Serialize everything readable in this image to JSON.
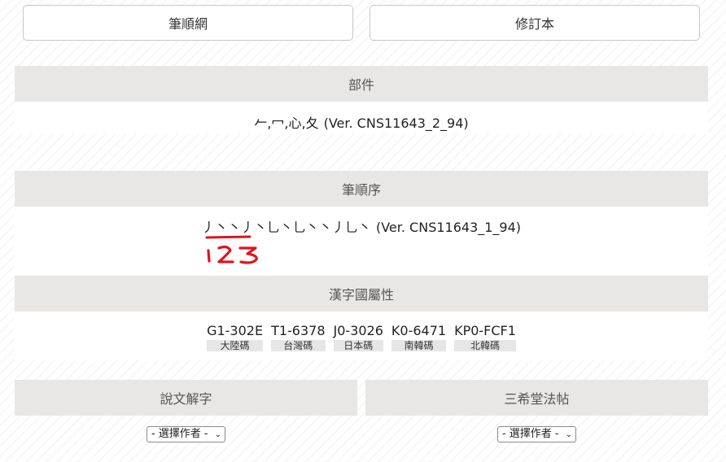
{
  "buttons": {
    "stroke_order_site": "筆順網",
    "revised_edition": "修訂本"
  },
  "components": {
    "heading": "部件",
    "value": "𠂉,冖,心,夂",
    "source": "(Ver. CNS11643_2_94)"
  },
  "stroke_order": {
    "heading": "筆順序",
    "strokes": "丿丶丶丿丶乚丶乚丶丶丿乚丶",
    "source": "(Ver. CNS11643_1_94)",
    "annotation": "123",
    "annotation_color": "#e0151c"
  },
  "attributes": {
    "heading": "漢字國屬性",
    "codes": [
      {
        "value": "G1-302E",
        "label": "大陸碼"
      },
      {
        "value": "T1-6378",
        "label": "台灣碼"
      },
      {
        "value": "J0-3026",
        "label": "日本碼"
      },
      {
        "value": "K0-6471",
        "label": "南韓碼"
      },
      {
        "value": "KP0-FCF1",
        "label": "北韓碼"
      }
    ]
  },
  "shuowen": {
    "heading": "說文解字",
    "select_value": "- 選擇作者 -"
  },
  "sanxitang": {
    "heading": "三希堂法帖",
    "select_value": "- 選擇作者 -"
  }
}
